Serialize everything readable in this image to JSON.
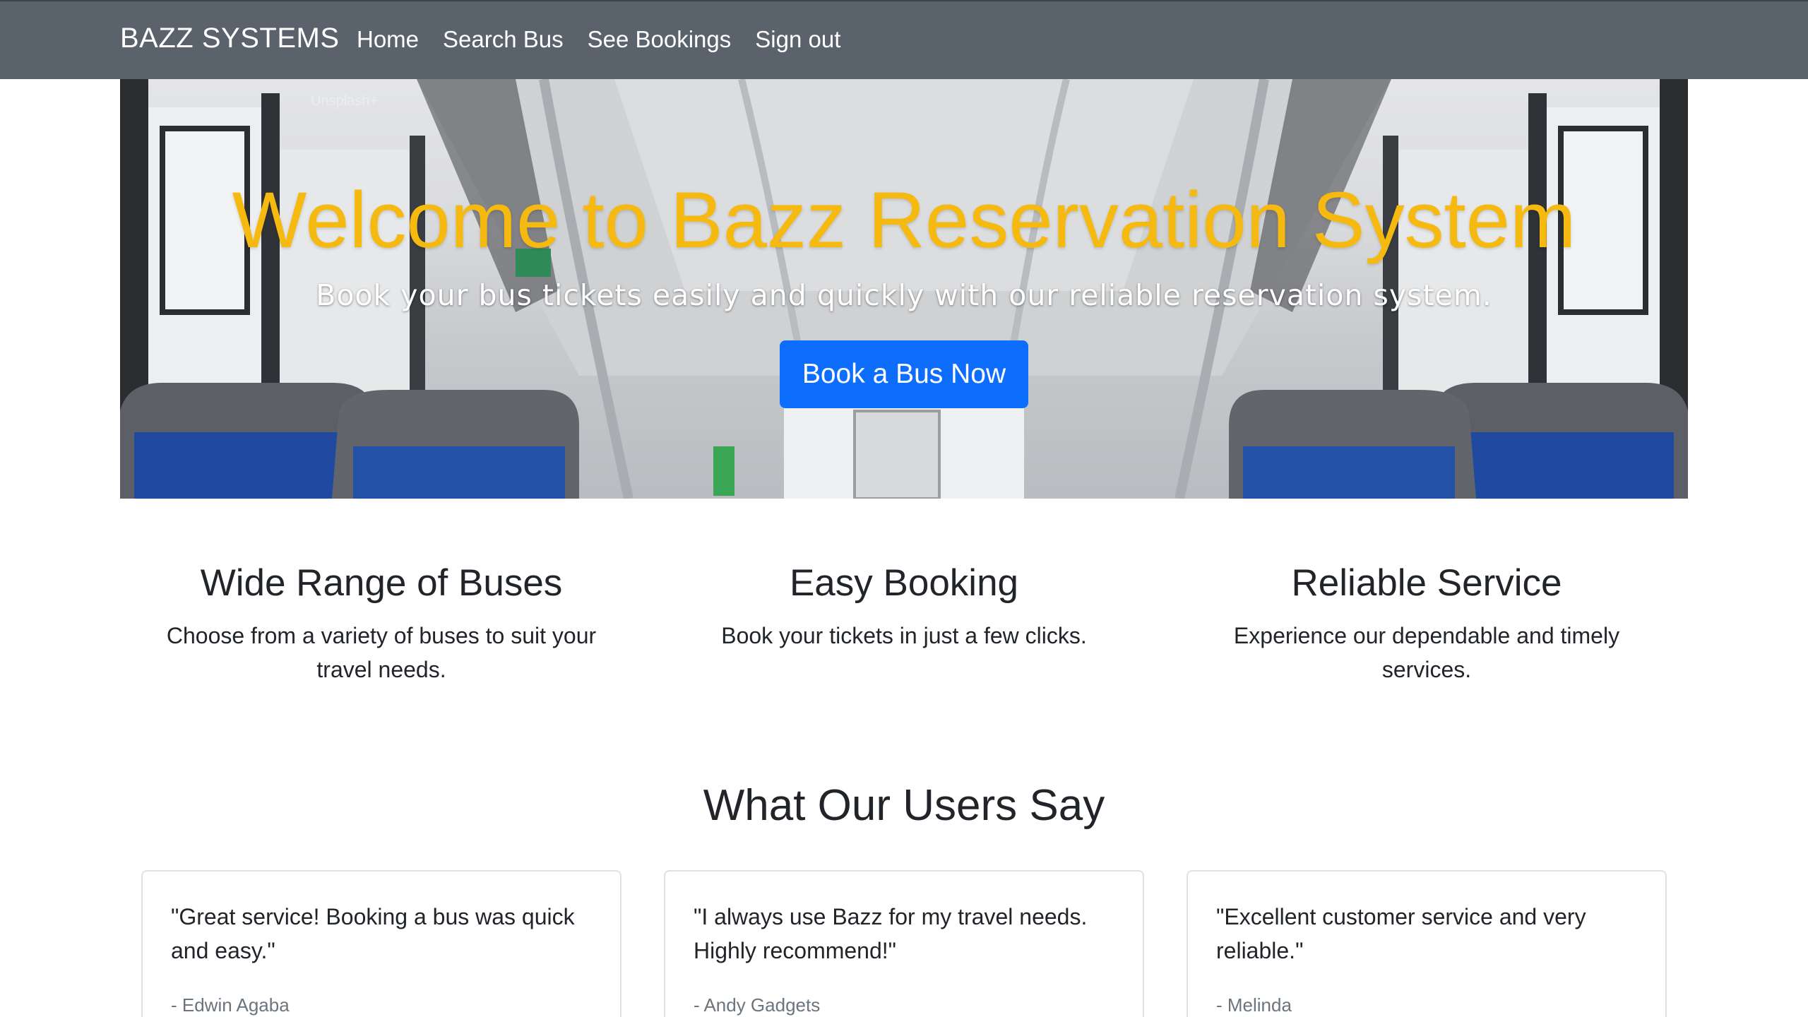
{
  "nav": {
    "brand": "BAZZ SYSTEMS",
    "links": [
      "Home",
      "Search Bus",
      "See Bookings",
      "Sign out"
    ]
  },
  "hero": {
    "title": "Welcome to Bazz Reservation System",
    "subtitle": "Book your bus tickets easily and quickly with our reliable reservation system.",
    "button": "Book a Bus Now",
    "watermark": "Unsplash+"
  },
  "features": [
    {
      "title": "Wide Range of Buses",
      "text": "Choose from a variety of buses to suit your travel needs."
    },
    {
      "title": "Easy Booking",
      "text": "Book your tickets in just a few clicks."
    },
    {
      "title": "Reliable Service",
      "text": "Experience our dependable and timely services."
    }
  ],
  "testimonials": {
    "title": "What Our Users Say",
    "items": [
      {
        "quote": "\"Great service! Booking a bus was quick and easy.\"",
        "author": "- Edwin Agaba"
      },
      {
        "quote": "\"I always use Bazz for my travel needs. Highly recommend!\"",
        "author": "- Andy Gadgets"
      },
      {
        "quote": "\"Excellent customer service and very reliable.\"",
        "author": "- Melinda"
      }
    ]
  },
  "colors": {
    "navbar": "#5a626b",
    "hero_title": "#f5b90f",
    "primary_button": "#0d6efd"
  }
}
